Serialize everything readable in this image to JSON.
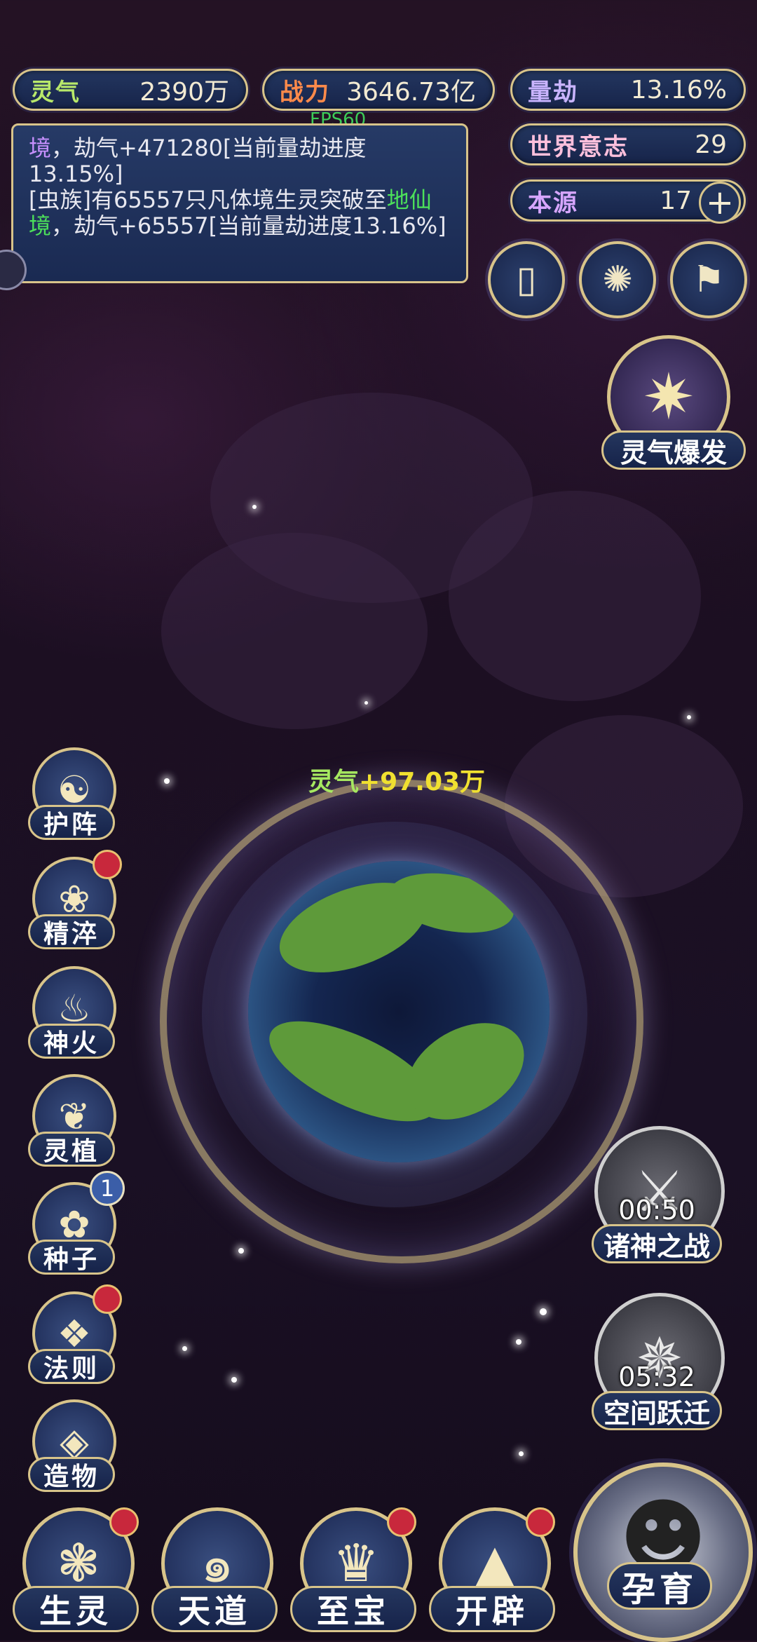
{
  "stats": {
    "lingqi": {
      "label": "灵气",
      "value": "2390万"
    },
    "zhanli": {
      "label": "战力",
      "value": "3646.73亿"
    },
    "liangjie": {
      "label": "量劫",
      "value": "13.16%"
    },
    "world_will": {
      "label": "世界意志",
      "value": "29"
    },
    "benyuan": {
      "label": "本源",
      "value": "17"
    }
  },
  "fps": "FPS60",
  "log": {
    "line1_a": "境",
    "line1_b": "，劫气+471280[当前量劫进度13.15%]",
    "line2_a": "[虫族]有65557只凡体境生灵突破至",
    "line2_hl": "地仙境",
    "line2_b": "，劫气+65557[当前量劫进度13.16%]"
  },
  "burst_label": "灵气爆发",
  "gain": {
    "prefix": "灵气",
    "value": "+97.03万"
  },
  "left_menu": [
    {
      "label": "护阵",
      "icon": "yin-yang-icon"
    },
    {
      "label": "精淬",
      "icon": "lotus-flame-icon",
      "badge": "dot"
    },
    {
      "label": "神火",
      "icon": "fire-icon"
    },
    {
      "label": "灵植",
      "icon": "plant-icon"
    },
    {
      "label": "种子",
      "icon": "seed-flower-icon",
      "badge": "1"
    },
    {
      "label": "法则",
      "icon": "rune-icon",
      "badge": "dot"
    },
    {
      "label": "造物",
      "icon": "diamond-icon"
    }
  ],
  "bottom_menu": [
    {
      "label": "生灵",
      "icon": "creature-icon",
      "badge": "dot"
    },
    {
      "label": "天道",
      "icon": "swirl-icon"
    },
    {
      "label": "至宝",
      "icon": "treasure-icon",
      "badge": "dot"
    },
    {
      "label": "开辟",
      "icon": "mountain-icon",
      "badge": "dot"
    }
  ],
  "events": [
    {
      "label": "诸神之战",
      "time": "00:50",
      "icon": "sword-icon"
    },
    {
      "label": "空间跃迁",
      "time": "05:32",
      "icon": "portal-icon"
    }
  ],
  "incubate_label": "孕育",
  "colors": {
    "gold": "#d8c48a",
    "panel": "#1a2a52",
    "highlight": "#4ce05a",
    "badge": "#c8283c"
  }
}
